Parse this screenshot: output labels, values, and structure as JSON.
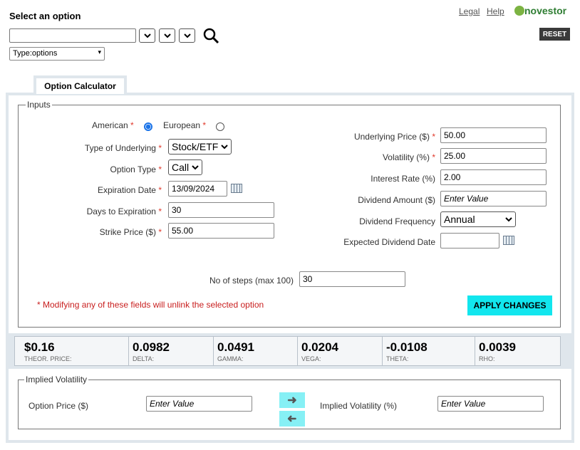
{
  "header": {
    "title": "Select an option",
    "type_select": "Type:options",
    "legal": "Legal",
    "help": "Help",
    "logo_text": "novestor",
    "reset": "RESET"
  },
  "tab": {
    "label": "Option Calculator"
  },
  "inputs": {
    "legend": "Inputs",
    "american_label": "American",
    "european_label": "European",
    "underlying_type_label": "Type of Underlying",
    "underlying_type_value": "Stock/ETF",
    "option_type_label": "Option Type",
    "option_type_value": "Call",
    "expiration_date_label": "Expiration Date",
    "expiration_date_value": "13/09/2024",
    "days_label": "Days to Expiration",
    "days_value": "30",
    "strike_label": "Strike Price ($)",
    "strike_value": "55.00",
    "underlying_price_label": "Underlying Price ($)",
    "underlying_price_value": "50.00",
    "volatility_label": "Volatility (%)",
    "volatility_value": "25.00",
    "interest_label": "Interest Rate (%)",
    "interest_value": "2.00",
    "div_amount_label": "Dividend Amount ($)",
    "div_amount_placeholder": "Enter Value",
    "div_freq_label": "Dividend Frequency",
    "div_freq_value": "Annual",
    "exp_div_date_label": "Expected Dividend Date",
    "steps_label": "No of steps (max 100)",
    "steps_value": "30",
    "warning": "* Modifying any of these fields will unlink the selected option",
    "apply": "APPLY CHANGES",
    "required_mark": "*"
  },
  "results": [
    {
      "value": "$0.16",
      "label": "THEOR. PRICE:"
    },
    {
      "value": "0.0982",
      "label": "DELTA:"
    },
    {
      "value": "0.0491",
      "label": "GAMMA:"
    },
    {
      "value": "0.0204",
      "label": "VEGA:"
    },
    {
      "value": "-0.0108",
      "label": "THETA:"
    },
    {
      "value": "0.0039",
      "label": "RHO:"
    }
  ],
  "implied": {
    "legend": "Implied Volatility",
    "option_price_label": "Option Price ($)",
    "option_price_placeholder": "Enter Value",
    "iv_label": "Implied Volatility (%)",
    "iv_placeholder": "Enter Value"
  },
  "colors": {
    "accent": "#12e6ee",
    "required": "#e0392b",
    "radio": "#1a73e8"
  }
}
